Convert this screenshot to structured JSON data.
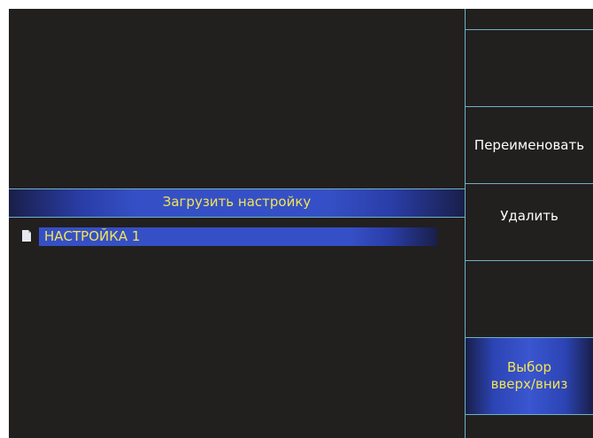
{
  "panel": {
    "title": "Загрузить настройку",
    "items": [
      {
        "label": "НАСТРОЙКА 1",
        "icon": "file-icon",
        "selected": true
      }
    ]
  },
  "softkeys": [
    {
      "label": ""
    },
    {
      "label": ""
    },
    {
      "label": "Переименовать"
    },
    {
      "label": "Удалить"
    },
    {
      "label": ""
    },
    {
      "label": "Выбор\nвверх/вниз"
    }
  ],
  "colors": {
    "background": "#221f1f",
    "highlight": "#3550c6",
    "text_accent": "#f2e454",
    "divider": "#6fb2c4"
  }
}
